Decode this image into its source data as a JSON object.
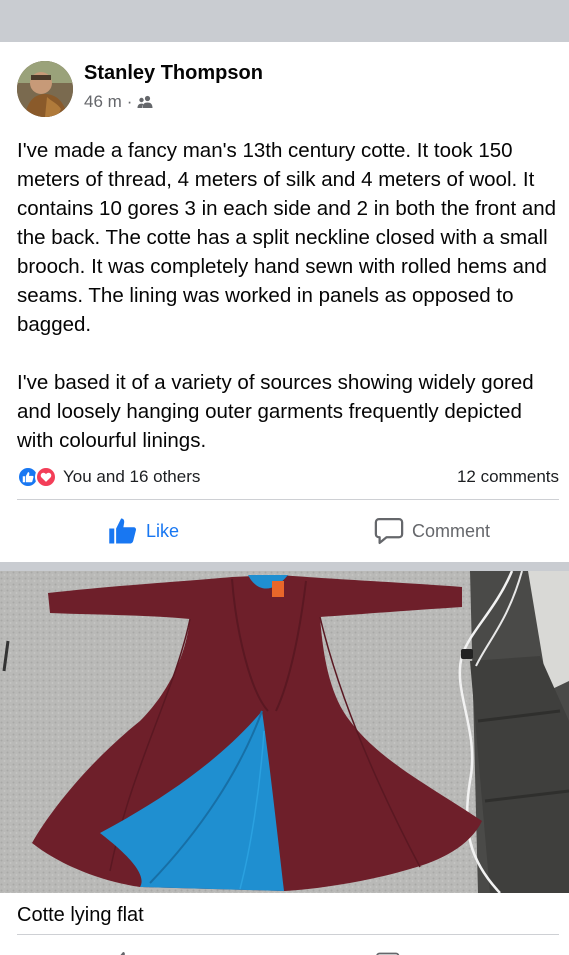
{
  "post": {
    "author": "Stanley Thompson",
    "time": "46 m",
    "separator": "·",
    "audience_icon": "friends-icon",
    "paragraphs": [
      "I've made a fancy man's 13th century cotte. It took 150 meters of thread, 4 meters of silk and 4 meters of wool. It contains 10 gores 3 in each side and 2 in both the front and the back. The cotte has a split neckline closed with a small brooch. It was completely hand sewn with rolled hems and seams. The lining was worked in panels as opposed to bagged.",
      "I've based it of a variety of sources showing widely gored and loosely hanging outer garments frequently depicted with colourful linings."
    ],
    "reactions_text": "You and 16 others",
    "comments_count": "12 comments"
  },
  "actions": {
    "like_label": "Like",
    "comment_label": "Comment"
  },
  "photo": {
    "caption": "Cotte lying flat"
  },
  "colors": {
    "accent": "#1877f2",
    "love": "#f33e58",
    "secondary_text": "#65676b",
    "separator_bg": "#c9ccd1",
    "garment": "#6e1f2a",
    "lining": "#1f8fd0"
  }
}
